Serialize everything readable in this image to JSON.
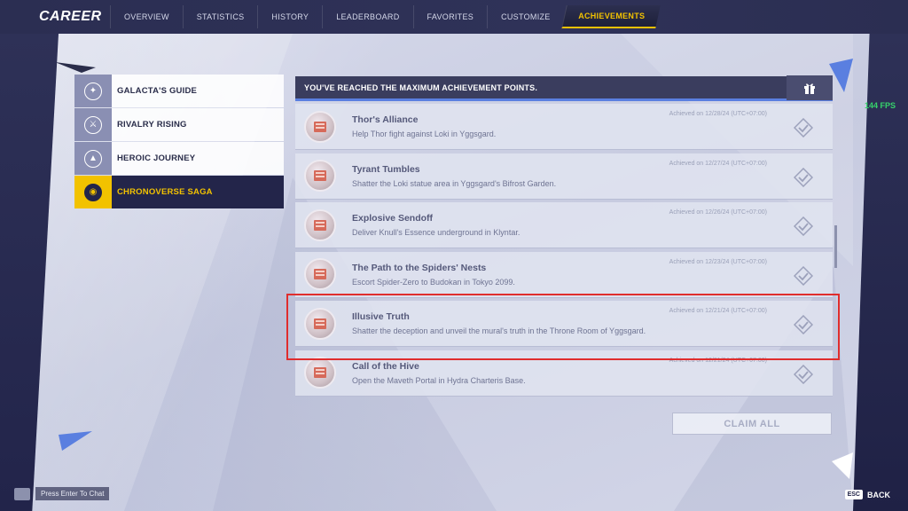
{
  "header": {
    "title": "CAREER",
    "tabs": [
      "OVERVIEW",
      "STATISTICS",
      "HISTORY",
      "LEADERBOARD",
      "FAVORITES",
      "CUSTOMIZE",
      "ACHIEVEMENTS"
    ],
    "active_tab": "ACHIEVEMENTS"
  },
  "sagas": [
    {
      "label": "GALACTA'S GUIDE",
      "icon": "galacta-icon"
    },
    {
      "label": "RIVALRY RISING",
      "icon": "rivalry-icon"
    },
    {
      "label": "HEROIC JOURNEY",
      "icon": "heroic-journey-icon"
    },
    {
      "label": "CHRONOVERSE SAGA",
      "icon": "chronoverse-icon",
      "active": true
    }
  ],
  "panel": {
    "header_text": "YOU'VE REACHED THE MAXIMUM ACHIEVEMENT POINTS.",
    "gift_icon": "gift-icon"
  },
  "achievements": [
    {
      "title": "Thor's Alliance",
      "desc": "Help Thor fight against Loki in Yggsgard.",
      "date": "Achieved on 12/28/24 (UTC+07:00)"
    },
    {
      "title": "Tyrant Tumbles",
      "desc": "Shatter the Loki statue area in Yggsgard's Bifrost Garden.",
      "date": "Achieved on 12/27/24 (UTC+07:00)"
    },
    {
      "title": "Explosive Sendoff",
      "desc": "Deliver Knull's Essence underground in Klyntar.",
      "date": "Achieved on 12/26/24 (UTC+07:00)"
    },
    {
      "title": "The Path to the Spiders' Nests",
      "desc": "Escort Spider-Zero to Budokan in Tokyo 2099.",
      "date": "Achieved on 12/23/24 (UTC+07:00)"
    },
    {
      "title": "Illusive Truth",
      "desc": "Shatter the deception and unveil the mural's truth in the Throne Room of Yggsgard.",
      "date": "Achieved on 12/21/24 (UTC+07:00)"
    },
    {
      "title": "Call of the Hive",
      "desc": "Open the Maveth Portal in Hydra Charteris Base.",
      "date": "Achieved on 12/21/24 (UTC+07:00)"
    }
  ],
  "claim_all": "CLAIM ALL",
  "fps": "144 FPS",
  "chat": "Press Enter To Chat",
  "back": {
    "key": "ESC",
    "label": "BACK"
  },
  "colors": {
    "accent": "#f2c200",
    "panel_header": "#3a3d5e",
    "highlight": "#e02d2d",
    "fps": "#36d36b"
  }
}
